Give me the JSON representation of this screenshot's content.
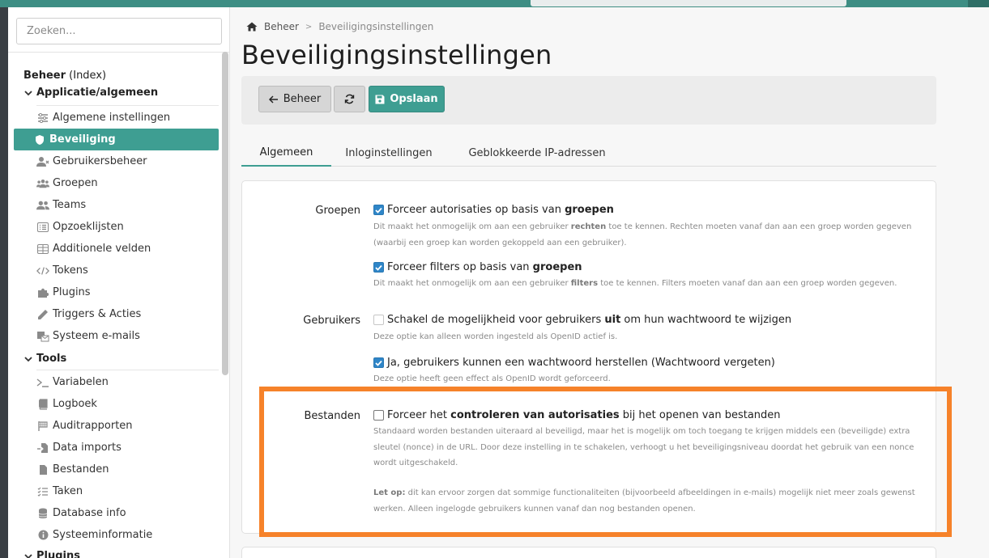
{
  "sidebar": {
    "search_placeholder": "Zoeken...",
    "index_bold": "Beheer",
    "index_rest": " (Index)",
    "section_app": "Applicatie/algemeen",
    "items_app": [
      {
        "label": "Algemene instellingen",
        "icon": "sliders-icon"
      },
      {
        "label": "Beveiliging",
        "icon": "shield-icon",
        "active": true
      },
      {
        "label": "Gebruikersbeheer",
        "icon": "user-icon"
      },
      {
        "label": "Groepen",
        "icon": "users-group-icon"
      },
      {
        "label": "Teams",
        "icon": "team-icon"
      },
      {
        "label": "Opzoeklijsten",
        "icon": "list-icon"
      },
      {
        "label": "Additionele velden",
        "icon": "table-icon"
      },
      {
        "label": "Tokens",
        "icon": "code-icon"
      },
      {
        "label": "Plugins",
        "icon": "puzzle-icon"
      },
      {
        "label": "Triggers & Acties",
        "icon": "pencil-icon"
      },
      {
        "label": "Systeem e-mails",
        "icon": "mail-icon"
      }
    ],
    "section_tools": "Tools",
    "items_tools": [
      {
        "label": "Variabelen",
        "icon": "terminal-icon"
      },
      {
        "label": "Logboek",
        "icon": "book-icon"
      },
      {
        "label": "Auditrapporten",
        "icon": "flag-icon"
      },
      {
        "label": "Data imports",
        "icon": "import-icon"
      },
      {
        "label": "Bestanden",
        "icon": "file-icon"
      },
      {
        "label": "Taken",
        "icon": "tasks-icon"
      },
      {
        "label": "Database info",
        "icon": "database-icon"
      },
      {
        "label": "Systeeminformatie",
        "icon": "info-icon"
      }
    ],
    "section_plugins": "Plugins"
  },
  "breadcrumb": {
    "root": "Beheer",
    "current": "Beveiligingsinstellingen"
  },
  "page_title": "Beveiligingsinstellingen",
  "toolbar": {
    "back_label": "Beheer",
    "save_label": "Opslaan"
  },
  "tabs": [
    "Algemeen",
    "Inloginstellingen",
    "Geblokkeerde IP-adressen"
  ],
  "settings": {
    "groups_label": "Groepen",
    "opt1_pre": "Forceer autorisaties op basis van ",
    "opt1_bold": "groepen",
    "help1_pre": "Dit maakt het onmogelijk om aan een gebruiker ",
    "help1_bold": "rechten",
    "help1_post": " toe te kennen. Rechten moeten vanaf dan aan een groep worden gegeven (waarbij een groep kan worden gekoppeld aan een gebruiker).",
    "opt2_pre": "Forceer filters op basis van ",
    "opt2_bold": "groepen",
    "help2_pre": "Dit maakt het onmogelijk om aan een gebruiker ",
    "help2_bold": "filters",
    "help2_post": " toe te kennen. Filters moeten vanaf dan aan een groep worden gegeven.",
    "users_label": "Gebruikers",
    "opt3_pre": "Schakel de mogelijkheid voor gebruikers ",
    "opt3_bold": "uit",
    "opt3_post": " om hun wachtwoord te wijzigen",
    "help3": "Deze optie kan alleen worden ingesteld als OpenID actief is.",
    "opt4": "Ja, gebruikers kunnen een wachtwoord herstellen (Wachtwoord vergeten)",
    "help4": "Deze optie heeft geen effect als OpenID wordt geforceerd.",
    "files_label": "Bestanden",
    "opt5_pre": "Forceer het ",
    "opt5_bold": "controleren van autorisaties",
    "opt5_post": " bij het openen van bestanden",
    "help5": "Standaard worden bestanden uiteraard al beveiligd, maar het is mogelijk om toch toegang te krijgen middels een (beveiligde) extra sleutel (nonce) in de URL. Door deze instelling in te schakelen, verhoogt u het beveiligingsniveau doordat het gebruik van een nonce wordt uitgeschakeld.",
    "help6_bold": "Let op:",
    "help6_post": " dit kan ervoor zorgen dat sommige functionaliteiten (bijvoorbeeld afbeeldingen in e-mails) mogelijk niet meer zoals gewenst werken. Alleen ingelogde gebruikers kunnen vanaf dan nog bestanden openen."
  },
  "colors": {
    "accent": "#3e9e92",
    "highlight": "#f6822a",
    "checkbox": "#2f86c8"
  }
}
